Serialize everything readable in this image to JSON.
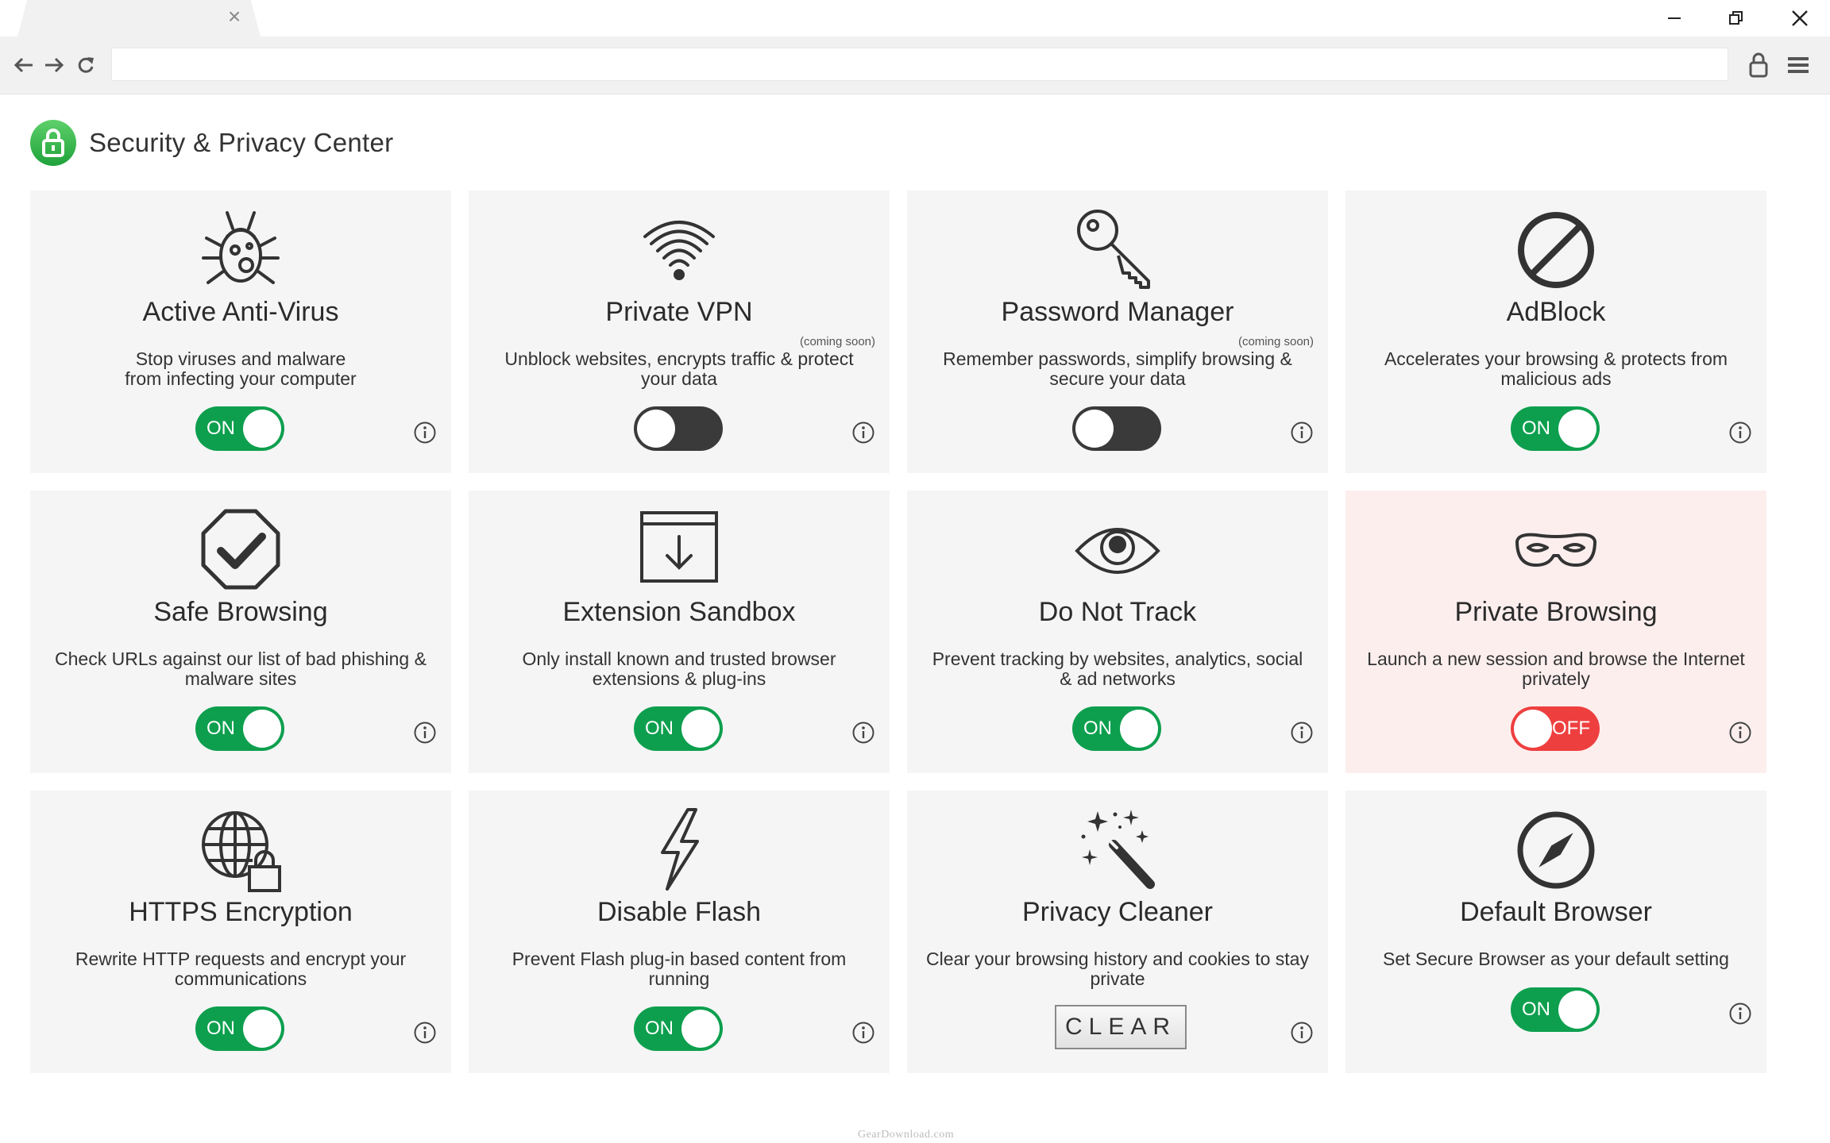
{
  "browser": {
    "tab_close": "×"
  },
  "page": {
    "title": "Security & Privacy Center"
  },
  "cards": [
    {
      "title": "Active Anti-Virus",
      "desc": "Stop viruses and malware from infecting your computer",
      "control": "toggle",
      "state": "on",
      "label": "ON",
      "note": ""
    },
    {
      "title": "Private VPN",
      "desc": "Unblock websites, encrypts traffic & protect your data",
      "control": "toggle",
      "state": "off",
      "label": "",
      "note": "(coming soon)"
    },
    {
      "title": "Password Manager",
      "desc": "Remember passwords, simplify browsing & secure your data",
      "control": "toggle",
      "state": "off",
      "label": "",
      "note": "(coming soon)"
    },
    {
      "title": "AdBlock",
      "desc": "Accelerates your browsing & protects from malicious ads",
      "control": "toggle",
      "state": "on",
      "label": "ON",
      "note": ""
    },
    {
      "title": "Safe Browsing",
      "desc": "Check URLs against our list of bad phishing & malware sites",
      "control": "toggle",
      "state": "on",
      "label": "ON",
      "note": ""
    },
    {
      "title": "Extension Sandbox",
      "desc": "Only install known and trusted browser extensions & plug-ins",
      "control": "toggle",
      "state": "on",
      "label": "ON",
      "note": ""
    },
    {
      "title": "Do Not Track",
      "desc": "Prevent tracking by websites, analytics, social & ad networks",
      "control": "toggle",
      "state": "on",
      "label": "ON",
      "note": ""
    },
    {
      "title": "Private Browsing",
      "desc": "Launch a new session and browse the Internet privately",
      "control": "toggle",
      "state": "off",
      "label": "OFF",
      "note": ""
    },
    {
      "title": "HTTPS Encryption",
      "desc": "Rewrite HTTP requests and encrypt your communications",
      "control": "toggle",
      "state": "on",
      "label": "ON",
      "note": ""
    },
    {
      "title": "Disable Flash",
      "desc": "Prevent Flash plug-in based content from running",
      "control": "toggle",
      "state": "on",
      "label": "ON",
      "note": ""
    },
    {
      "title": "Privacy Cleaner",
      "desc": "Clear your browsing history and cookies to stay private",
      "control": "button",
      "state": "",
      "label": "CLEAR",
      "note": ""
    },
    {
      "title": "Default Browser",
      "desc": "Set Secure Browser as your default setting",
      "control": "toggle",
      "state": "on",
      "label": "ON",
      "note": ""
    }
  ],
  "colors": {
    "on": "#0d9f4e",
    "off": "#3a3a3a",
    "off_alert": "#ee3f3f",
    "card_bg": "#f5f5f5",
    "card_alert_bg": "#fdeeee"
  },
  "icons": {
    "card_icons": [
      "bug-icon",
      "wifi-icon",
      "key-icon",
      "block-icon",
      "shield-check-icon",
      "sandbox-icon",
      "eye-icon",
      "mask-icon",
      "globe-lock-icon",
      "lightning-icon",
      "magic-wand-icon",
      "compass-icon"
    ]
  },
  "watermark": "GearDownload.com"
}
